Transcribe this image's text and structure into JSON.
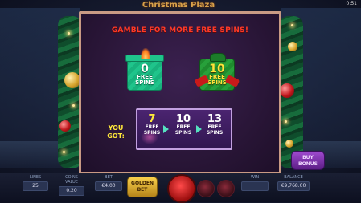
{
  "header": {
    "title": "Christmas Plaza",
    "clock": "0:51"
  },
  "modal": {
    "title": "GAMBLE FOR MORE FREE SPINS!",
    "options": [
      {
        "value": "0",
        "label1": "FREE",
        "label2": "SPINS"
      },
      {
        "value": "10",
        "label1": "FREE",
        "label2": "SPINS"
      }
    ],
    "you_got_line1": "YOU",
    "you_got_line2": "GOT:",
    "results": [
      {
        "value": "7",
        "label1": "FREE",
        "label2": "SPINS"
      },
      {
        "value": "10",
        "label1": "FREE",
        "label2": "SPINS"
      },
      {
        "value": "13",
        "label1": "FREE",
        "label2": "SPINS"
      }
    ]
  },
  "footer": {
    "stats": [
      {
        "label": "LINES",
        "value": "25"
      },
      {
        "label": "COINS VALUE",
        "value": "0.20"
      },
      {
        "label": "BET",
        "value": "€4.00"
      },
      {
        "label": "WIN",
        "value": ""
      },
      {
        "label": "BALANCE",
        "value": "€9,768.00"
      }
    ],
    "gold_bet_line1": "GOLDEN",
    "gold_bet_line2": "BET",
    "buy_bonus_line1": "BUY",
    "buy_bonus_line2": "BONUS"
  },
  "colors": {
    "title_red": "#ff3a28",
    "frame": "#c99a84",
    "yellow": "#ffe83a",
    "gift_green": "#1fc48b"
  }
}
